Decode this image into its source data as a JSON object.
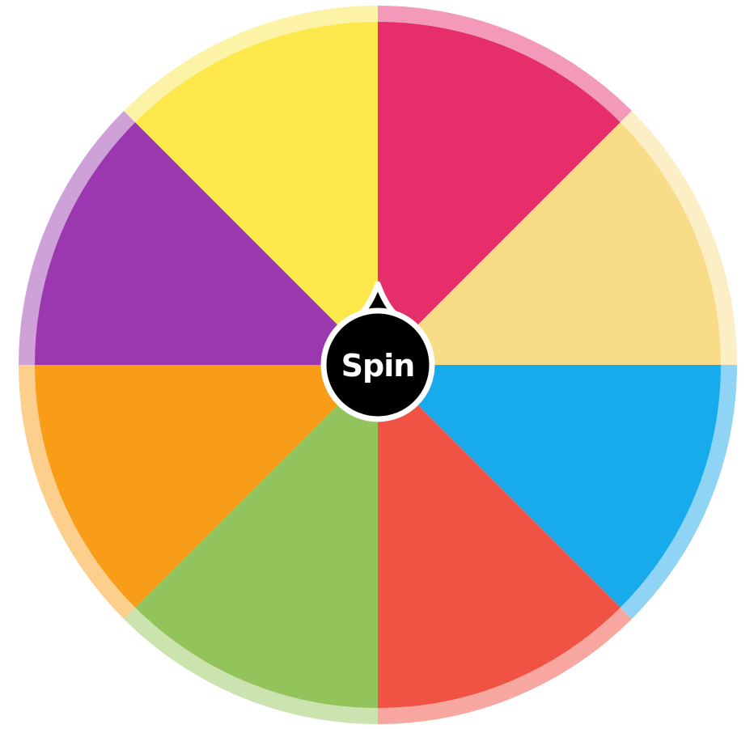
{
  "wheel": {
    "segments": [
      {
        "color": "#E62E6B",
        "rim_color": "#F39ABA"
      },
      {
        "color": "#F9DC87",
        "rim_color": "#FCEFC6"
      },
      {
        "color": "#18ABEC",
        "rim_color": "#8FD4F5"
      },
      {
        "color": "#F05344",
        "rim_color": "#F8A7A0"
      },
      {
        "color": "#93C45B",
        "rim_color": "#CBE3AE"
      },
      {
        "color": "#F99D18",
        "rim_color": "#FCCF8D"
      },
      {
        "color": "#9B38B0",
        "rim_color": "#CEA1D8"
      },
      {
        "color": "#FCE84A",
        "rim_color": "#FDF3A6"
      }
    ]
  },
  "spin_button": {
    "label": "Spin",
    "color": "#000000",
    "border_color": "#ffffff"
  }
}
